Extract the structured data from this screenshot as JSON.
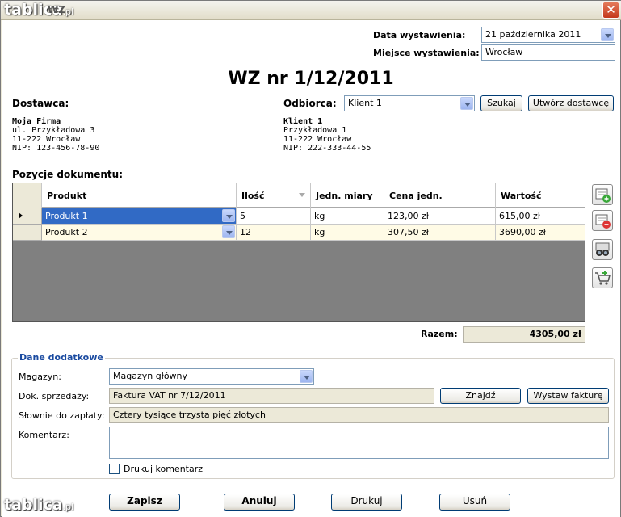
{
  "window": {
    "title": "WZ",
    "close_glyph": "✕"
  },
  "watermark": {
    "brand": "tablica",
    "suffix": ".pl"
  },
  "header": {
    "issue_date_label": "Data wystawienia:",
    "issue_date_value": "21 października 2011",
    "issue_place_label": "Miejsce wystawienia:",
    "issue_place_value": "Wrocław"
  },
  "document_title": "WZ nr 1/12/2011",
  "supplier": {
    "label": "Dostawca:",
    "name": "Moja Firma",
    "street": "ul. Przykładowa 3",
    "city": "11-222 Wrocław",
    "nip": "NIP: 123-456-78-90"
  },
  "recipient": {
    "label": "Odbiorca:",
    "selected": "Klient 1",
    "search_button": "Szukaj",
    "create_button": "Utwórz dostawcę",
    "name": "Klient 1",
    "street": "Przykładowa 1",
    "city": "11-222 Wrocław",
    "nip": "NIP: 222-333-44-55"
  },
  "items": {
    "label": "Pozycje dokumentu:",
    "columns": [
      "Produkt",
      "Ilość",
      "Jedn. miary",
      "Cena jedn.",
      "Wartość"
    ],
    "rows": [
      {
        "product": "Produkt 1",
        "qty": "5",
        "unit": "kg",
        "price": "123,00 zł",
        "value": "615,00 zł",
        "selected": true
      },
      {
        "product": "Produkt 2",
        "qty": "12",
        "unit": "kg",
        "price": "307,50 zł",
        "value": "3690,00 zł",
        "selected": false
      }
    ],
    "total_label": "Razem:",
    "total_value": "4305,00 zł",
    "side_icons": [
      "add-row-icon",
      "remove-row-icon",
      "search-binoculars-icon",
      "cart-add-icon"
    ]
  },
  "extra": {
    "title": "Dane dodatkowe",
    "warehouse_label": "Magazyn:",
    "warehouse_value": "Magazyn główny",
    "sales_doc_label": "Dok. sprzedaży:",
    "sales_doc_value": "Faktura VAT nr 7/12/2011",
    "find_button": "Znajdź",
    "invoice_button": "Wystaw fakturę",
    "words_label": "Słownie do zapłaty:",
    "words_value": "Cztery tysiące trzysta pięć złotych",
    "comment_label": "Komentarz:",
    "comment_value": "",
    "print_comment_label": "Drukuj komentarz",
    "print_comment_checked": false
  },
  "footer": {
    "save": "Zapisz",
    "cancel": "Anuluj",
    "print": "Drukuj",
    "delete": "Usuń"
  },
  "colors": {
    "selection": "#316ac5",
    "row_alt": "#fffbe6",
    "section_title": "#1a4aa0",
    "grid_empty": "#808080"
  }
}
